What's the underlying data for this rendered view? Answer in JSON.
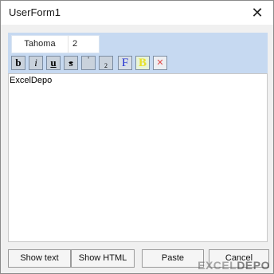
{
  "window": {
    "title": "UserForm1",
    "close_symbol": "✕"
  },
  "toolbar": {
    "font_name": "Tahoma",
    "font_size": "2",
    "buttons": [
      {
        "name": "bold-button",
        "symbol": "b"
      },
      {
        "name": "italic-button",
        "symbol": "i"
      },
      {
        "name": "underline-button",
        "symbol": "u"
      },
      {
        "name": "strikethrough-button",
        "symbol": "s"
      },
      {
        "name": "superscript-button",
        "symbol": "'"
      },
      {
        "name": "subscript-button",
        "symbol": "2"
      },
      {
        "name": "font-color-button",
        "symbol": "F"
      },
      {
        "name": "back-color-button",
        "symbol": "B"
      },
      {
        "name": "clear-format-button",
        "symbol": "✕"
      }
    ]
  },
  "editor": {
    "content": "ExcelDepo"
  },
  "actions": {
    "show_text": "Show text",
    "show_html": "Show HTML",
    "paste": "Paste",
    "cancel": "Cancel"
  },
  "watermark": {
    "left": "EXCEL",
    "right": "DEPO"
  }
}
